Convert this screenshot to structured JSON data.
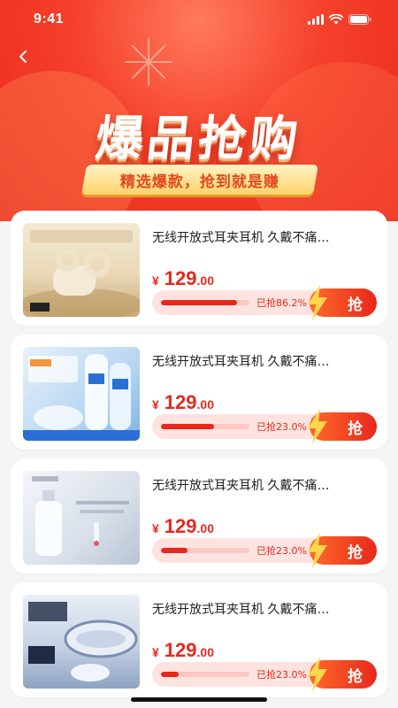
{
  "status": {
    "time": "9:41"
  },
  "banner": {
    "title": "爆品抢购",
    "subtitle": "精选爆款，抢到就是赚"
  },
  "colors": {
    "accent": "#e8281c",
    "accent_light": "#fde3e0",
    "gold": "#ffd36b"
  },
  "products": [
    {
      "title": "无线开放式耳夹耳机 久戴不痛…",
      "currency": "¥",
      "price_int": "129",
      "price_dec": ".00",
      "grab_label": "已抢86.2%",
      "progress": 0.862,
      "button": "抢",
      "image_icon": "earbuds-image"
    },
    {
      "title": "无线开放式耳夹耳机 久戴不痛…",
      "currency": "¥",
      "price_int": "129",
      "price_dec": ".00",
      "grab_label": "已抢23.0%",
      "progress": 0.6,
      "button": "抢",
      "image_icon": "sunscreen-image"
    },
    {
      "title": "无线开放式耳夹耳机 久戴不痛…",
      "currency": "¥",
      "price_int": "129",
      "price_dec": ".00",
      "grab_label": "已抢23.0%",
      "progress": 0.3,
      "button": "抢",
      "image_icon": "serum-bottle-image"
    },
    {
      "title": "无线开放式耳夹耳机 久戴不痛…",
      "currency": "¥",
      "price_int": "129",
      "price_dec": ".00",
      "grab_label": "已抢23.0%",
      "progress": 0.2,
      "button": "抢",
      "image_icon": "eye-mask-image"
    }
  ]
}
